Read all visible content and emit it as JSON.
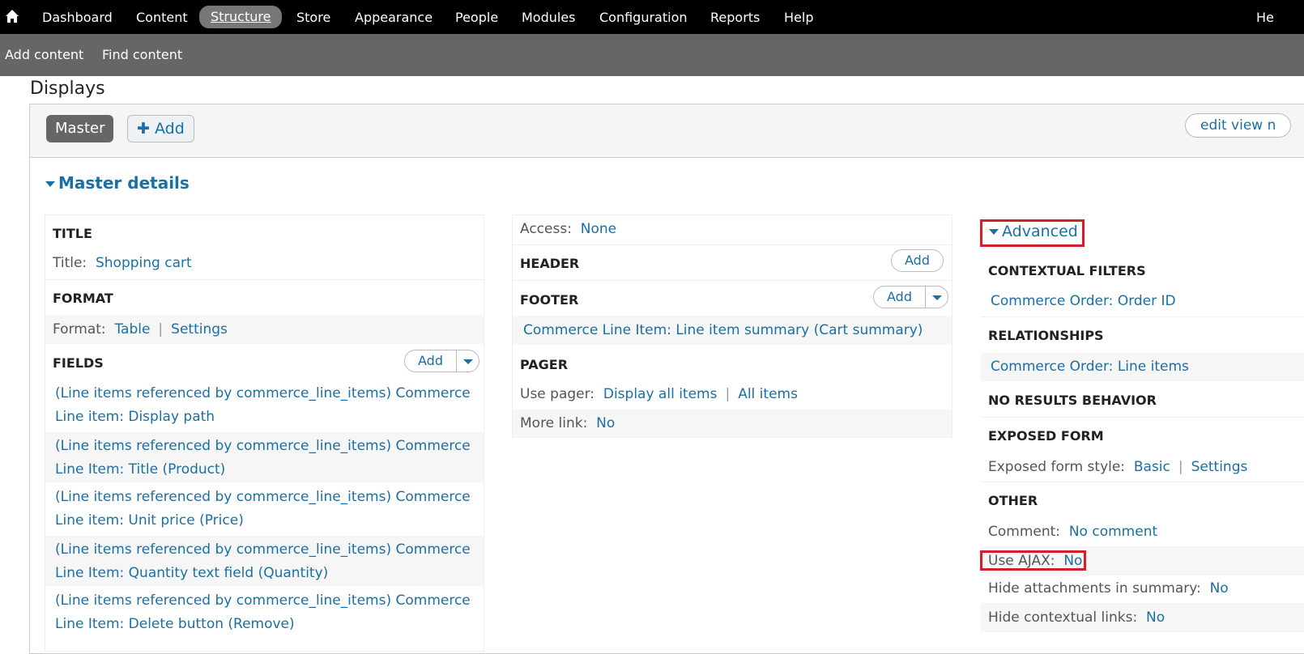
{
  "topbar": {
    "nav": [
      "Dashboard",
      "Content",
      "Structure",
      "Store",
      "Appearance",
      "People",
      "Modules",
      "Configuration",
      "Reports",
      "Help"
    ],
    "active": "Structure",
    "right_truncated": "He"
  },
  "shortcuts": [
    "Add content",
    "Find content"
  ],
  "page_title": "Displays",
  "display_tabs": {
    "master": "Master",
    "add": "Add",
    "edit_view": "edit view n"
  },
  "master_details": "Master details",
  "left": {
    "title_head": "TITLE",
    "title_label": "Title:",
    "title_value": "Shopping cart",
    "format_head": "FORMAT",
    "format_label": "Format:",
    "format_value": "Table",
    "format_settings": "Settings",
    "fields_head": "FIELDS",
    "fields_add": "Add",
    "fields": [
      [
        "(Line items referenced by commerce_line_items) Commerce",
        "Line item: Display path"
      ],
      [
        "(Line items referenced by commerce_line_items) Commerce",
        "Line Item: Title (Product)"
      ],
      [
        "(Line items referenced by commerce_line_items) Commerce",
        "Line item: Unit price (Price)"
      ],
      [
        "(Line items referenced by commerce_line_items) Commerce",
        "Line Item: Quantity text field (Quantity)"
      ],
      [
        "(Line items referenced by commerce_line_items) Commerce",
        "Line Item: Delete button (Remove)"
      ]
    ]
  },
  "middle": {
    "access_label": "Access:",
    "access_value": "None",
    "header_head": "HEADER",
    "header_add": "Add",
    "footer_head": "FOOTER",
    "footer_add": "Add",
    "footer_item": "Commerce Line Item: Line item summary (Cart summary)",
    "pager_head": "PAGER",
    "pager_label": "Use pager:",
    "pager_value": "Display all items",
    "pager_value2": "All items",
    "more_label": "More link:",
    "more_value": "No"
  },
  "right": {
    "advanced": "Advanced",
    "ctx_head": "CONTEXTUAL FILTERS",
    "ctx_item": "Commerce Order: Order ID",
    "rel_head": "RELATIONSHIPS",
    "rel_item": "Commerce Order: Line items",
    "nores_head": "NO RESULTS BEHAVIOR",
    "exposed_head": "EXPOSED FORM",
    "exposed_label": "Exposed form style:",
    "exposed_value": "Basic",
    "exposed_settings": "Settings",
    "other_head": "OTHER",
    "comment_label": "Comment:",
    "comment_value": "No comment",
    "ajax_label": "Use AJAX:",
    "ajax_value": "No",
    "hide_attach_label": "Hide attachments in summary:",
    "hide_attach_value": "No",
    "hide_ctx_label": "Hide contextual links:",
    "hide_ctx_value": "No"
  },
  "colors": {
    "link": "#1a6fa3",
    "highlight": "#d0202a"
  }
}
